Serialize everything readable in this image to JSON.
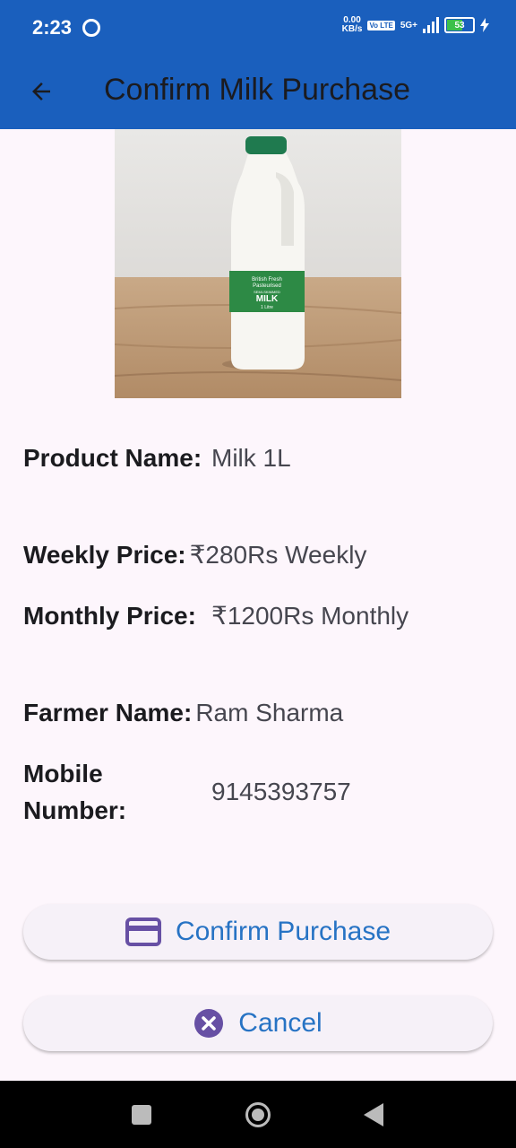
{
  "status_bar": {
    "time": "2:23",
    "net_speed_value": "0.00",
    "net_speed_unit": "KB/s",
    "volte": "Vo LTE",
    "network": "5G+",
    "battery": "53"
  },
  "app_bar": {
    "title": "Confirm Milk Purchase",
    "back_icon": "arrow-left-icon"
  },
  "product_image": {
    "bottle_label_line1": "British Fresh",
    "bottle_label_line2": "Pasteurised",
    "bottle_label_line3": "SEMI-SKIMMED",
    "bottle_label_main": "MILK",
    "bottle_label_size": "1 Litre"
  },
  "details": [
    {
      "label": "Product Name:",
      "value": "Milk 1L"
    },
    {
      "label": "Weekly Price:",
      "value": "₹280Rs Weekly"
    },
    {
      "label": "Monthly Price:",
      "value": "₹1200Rs Monthly"
    },
    {
      "label": "Farmer Name:",
      "value": "Ram Sharma"
    },
    {
      "label": "Mobile Number:",
      "value": "9145393757"
    }
  ],
  "actions": {
    "confirm_label": "Confirm Purchase",
    "confirm_icon": "credit-card-icon",
    "cancel_label": "Cancel",
    "cancel_icon": "cancel-circle-icon"
  },
  "colors": {
    "app_bar": "#1a5fbd",
    "background": "#fdf6fc",
    "button_text": "#2773c4",
    "icon": "#6750a4"
  }
}
